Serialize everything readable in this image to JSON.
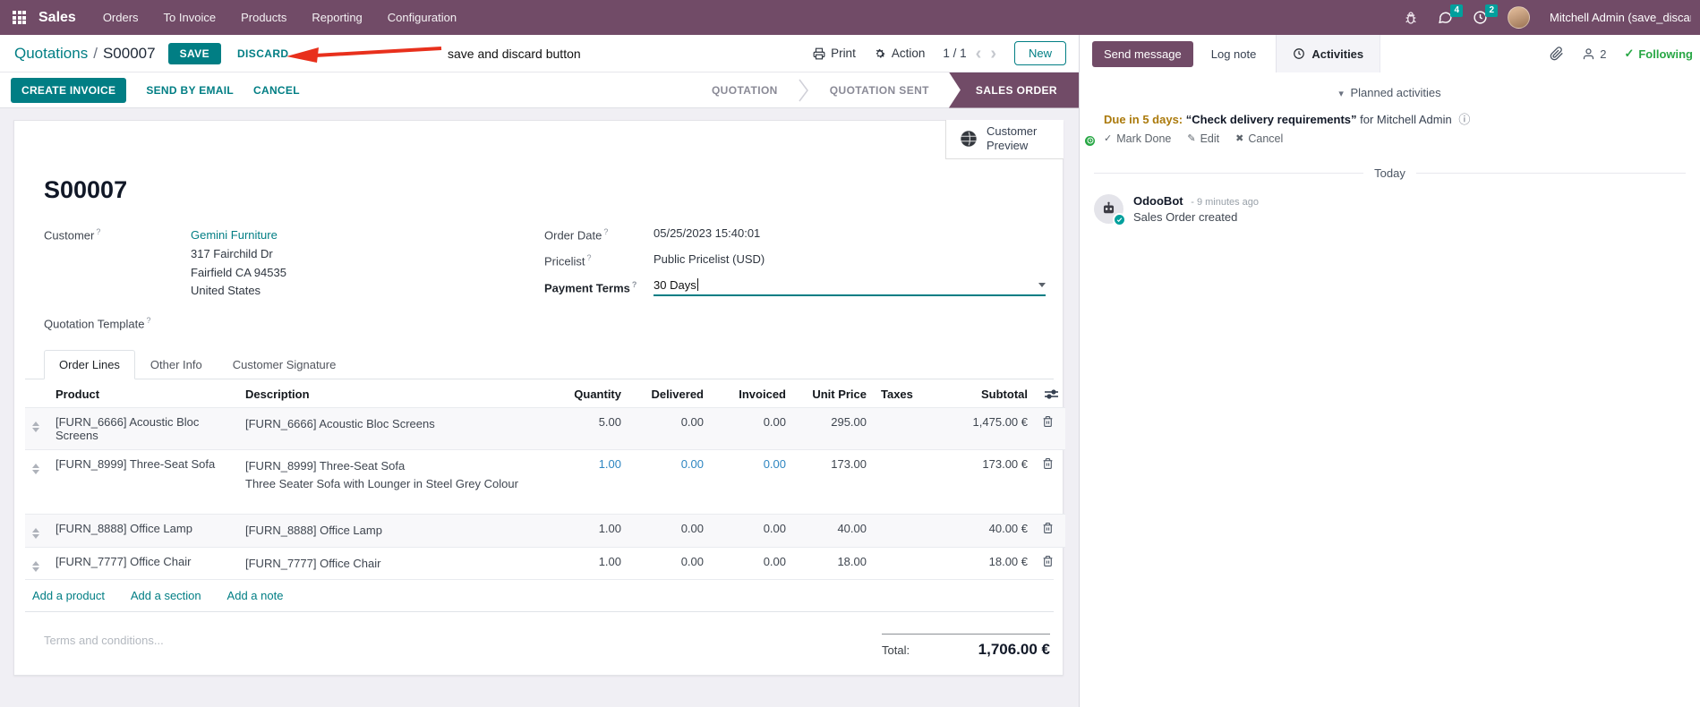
{
  "colors": {
    "brand_purple": "#714B67",
    "primary_teal": "#017E84",
    "badge_teal": "#00A09D",
    "following_green": "#28a745",
    "due_amber": "#ab7a0c",
    "edited_blue": "#2e86c1",
    "annotation_red": "#e8301c"
  },
  "topbar": {
    "app_name": "Sales",
    "menus": [
      "Orders",
      "To Invoice",
      "Products",
      "Reporting",
      "Configuration"
    ],
    "messages_badge": "4",
    "activities_badge": "2",
    "user_name": "Mitchell Admin (save_discar"
  },
  "control_panel": {
    "breadcrumb_parent": "Quotations",
    "breadcrumb_sep": "/",
    "breadcrumb_current": "S00007",
    "save_label": "SAVE",
    "discard_label": "DISCARD",
    "print_label": "Print",
    "action_label": "Action",
    "pager": "1 / 1",
    "prev": "‹",
    "next": "›",
    "new_label": "New"
  },
  "annotation": {
    "text": "save and discard button"
  },
  "statusbar": {
    "create_invoice": "CREATE INVOICE",
    "send_by_email": "SEND BY EMAIL",
    "cancel": "CANCEL",
    "stages": [
      {
        "label": "QUOTATION",
        "active": false
      },
      {
        "label": "QUOTATION SENT",
        "active": false
      },
      {
        "label": "SALES ORDER",
        "active": true
      }
    ]
  },
  "sheet": {
    "help_marker": "?",
    "preview_button": "Customer Preview",
    "title": "S00007",
    "fields": {
      "customer_label": "Customer",
      "customer_name": "Gemini Furniture",
      "address": [
        "317 Fairchild Dr",
        "Fairfield CA 94535",
        "United States"
      ],
      "quotation_template_label": "Quotation Template",
      "order_date_label": "Order Date",
      "order_date": "05/25/2023 15:40:01",
      "pricelist_label": "Pricelist",
      "pricelist": "Public Pricelist (USD)",
      "payment_terms_label": "Payment Terms",
      "payment_terms": "30 Days"
    },
    "tabs": [
      {
        "label": "Order Lines",
        "active": true
      },
      {
        "label": "Other Info",
        "active": false
      },
      {
        "label": "Customer Signature",
        "active": false
      }
    ],
    "table": {
      "columns": [
        "Product",
        "Description",
        "Quantity",
        "Delivered",
        "Invoiced",
        "Unit Price",
        "Taxes",
        "Subtotal"
      ],
      "rows": [
        {
          "product": "[FURN_6666] Acoustic Bloc Screens",
          "description": [
            "[FURN_6666] Acoustic Bloc Screens"
          ],
          "quantity": "5.00",
          "delivered": "0.00",
          "invoiced": "0.00",
          "unit_price": "295.00",
          "taxes": "",
          "subtotal": "1,475.00 €",
          "highlight": false
        },
        {
          "product": "[FURN_8999] Three-Seat Sofa",
          "description": [
            "[FURN_8999] Three-Seat Sofa",
            "Three Seater Sofa with Lounger in Steel Grey Colour"
          ],
          "quantity": "1.00",
          "delivered": "0.00",
          "invoiced": "0.00",
          "unit_price": "173.00",
          "taxes": "",
          "subtotal": "173.00 €",
          "highlight": true
        },
        {
          "product": "[FURN_8888] Office Lamp",
          "description": [
            "[FURN_8888] Office Lamp"
          ],
          "quantity": "1.00",
          "delivered": "0.00",
          "invoiced": "0.00",
          "unit_price": "40.00",
          "taxes": "",
          "subtotal": "40.00 €",
          "highlight": false
        },
        {
          "product": "[FURN_7777] Office Chair",
          "description": [
            "[FURN_7777] Office Chair"
          ],
          "quantity": "1.00",
          "delivered": "0.00",
          "invoiced": "0.00",
          "unit_price": "18.00",
          "taxes": "",
          "subtotal": "18.00 €",
          "highlight": false
        }
      ],
      "footer_links": [
        "Add a product",
        "Add a section",
        "Add a note"
      ]
    },
    "terms_placeholder": "Terms and conditions...",
    "total_label": "Total:",
    "total_value": "1,706.00 €"
  },
  "chatter": {
    "send_message": "Send message",
    "log_note": "Log note",
    "activities": "Activities",
    "follower_count": "2",
    "following_label": "Following",
    "planned_header": "Planned activities",
    "activity": {
      "due": "Due in 5 days:",
      "summary": "“Check delivery requirements”",
      "for_assignee": "for Mitchell Admin",
      "mark_done": "Mark Done",
      "edit": "Edit",
      "cancel": "Cancel"
    },
    "date_separator": "Today",
    "message": {
      "author": "OdooBot",
      "time": "- 9 minutes ago",
      "body": "Sales Order created"
    }
  }
}
